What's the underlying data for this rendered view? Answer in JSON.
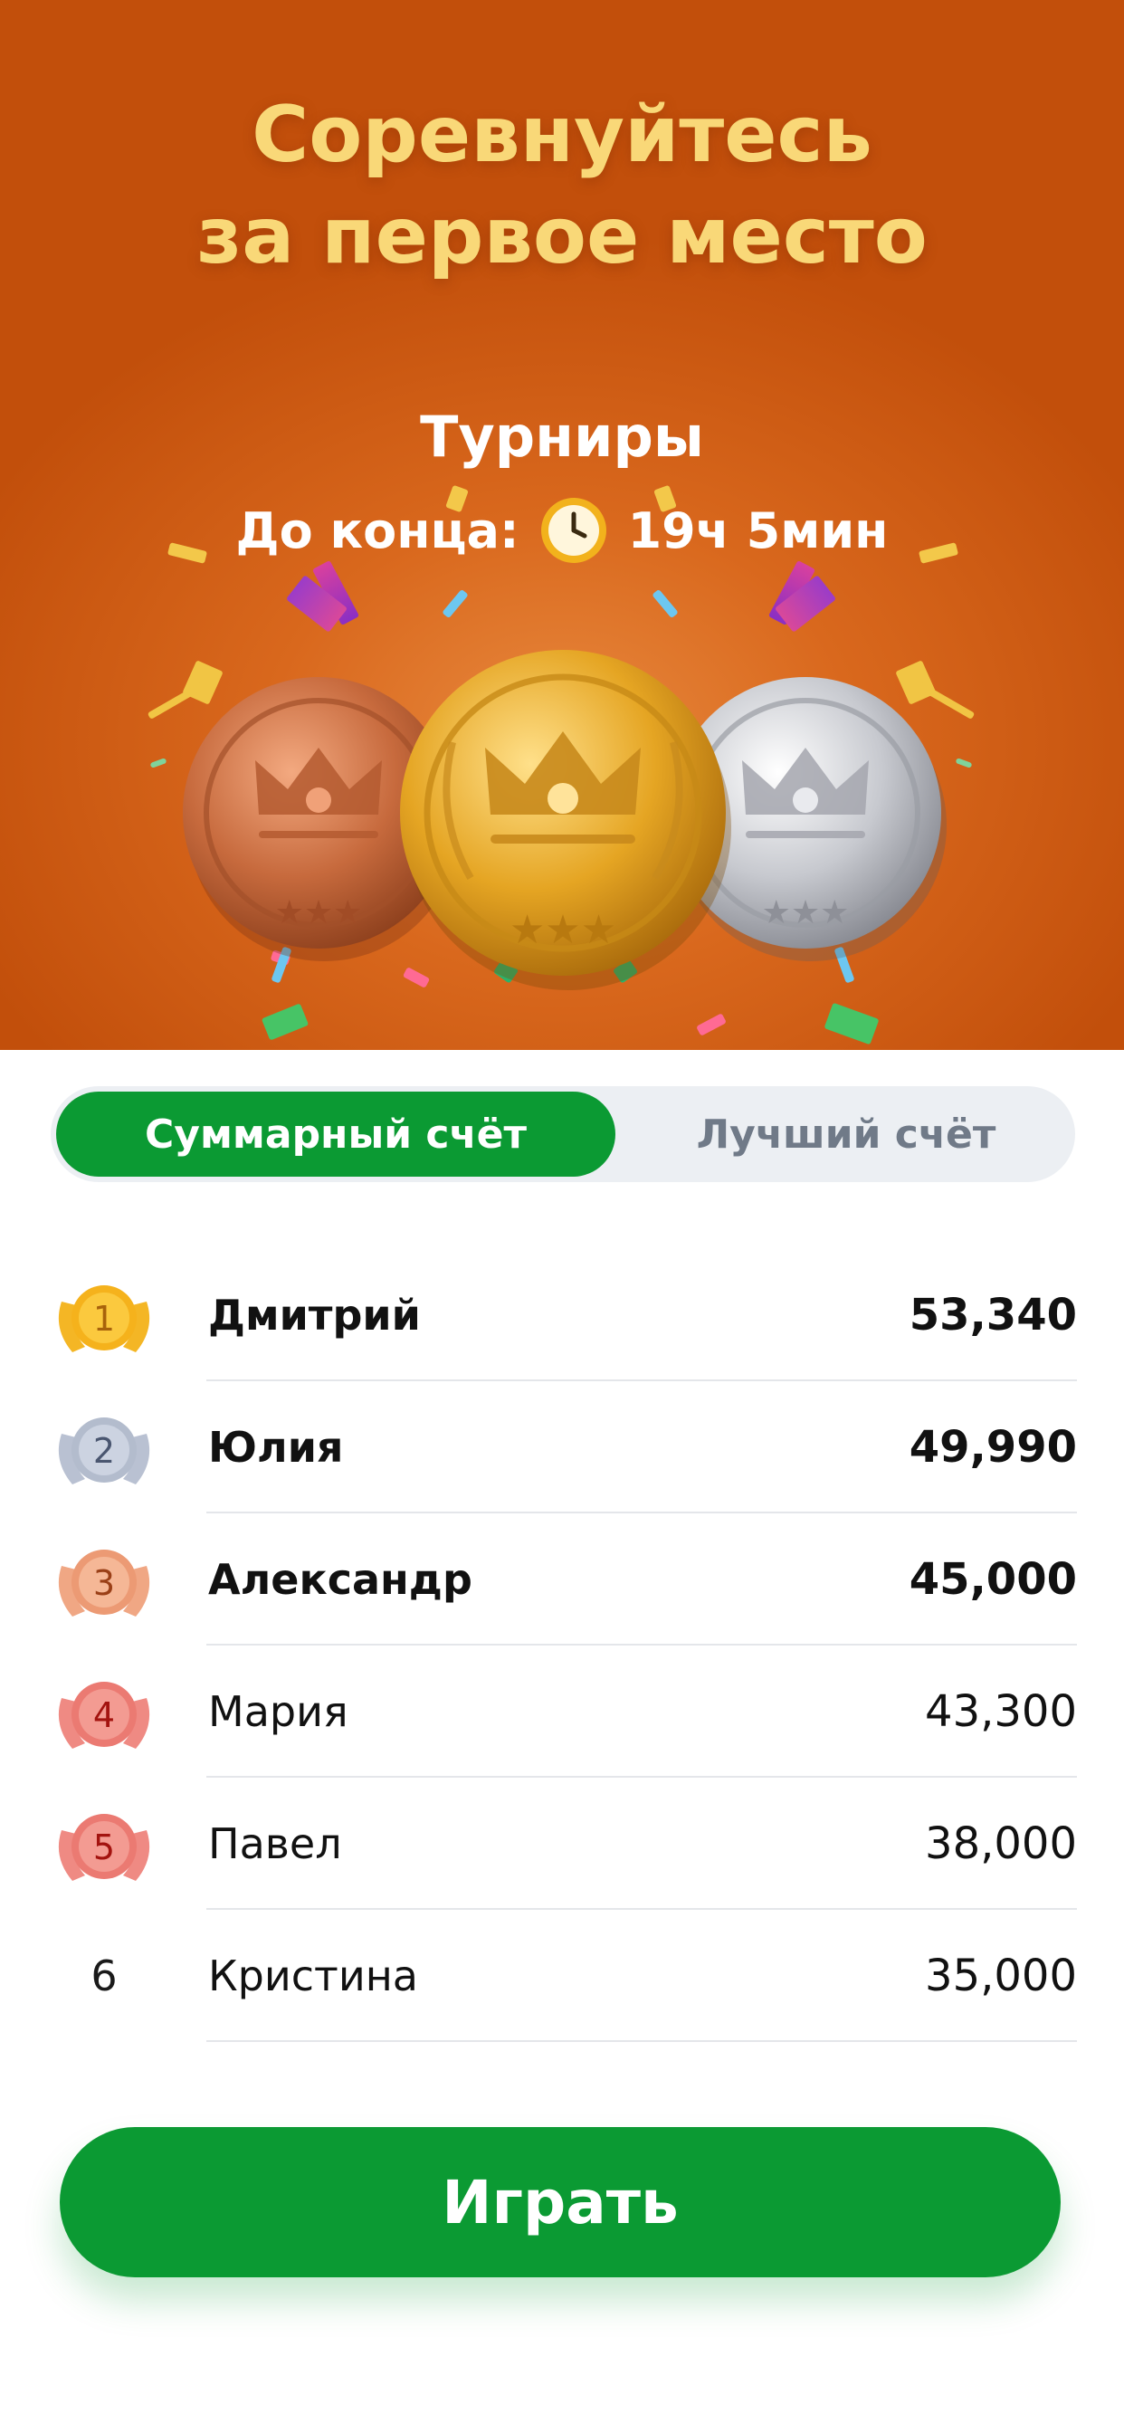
{
  "hero": {
    "title_line1": "Соревнуйтесь",
    "title_line2": "за первое место",
    "section": "Турниры",
    "timer_label": "До конца:",
    "timer_value": "19ч 5мин",
    "timer_icon": "clock-icon",
    "medal_icons": [
      "bronze-crown-medal-icon",
      "gold-crown-medal-icon",
      "silver-crown-medal-icon"
    ]
  },
  "tabs": [
    {
      "label": "Суммарный счёт",
      "selected": true
    },
    {
      "label": "Лучший счёт",
      "selected": false
    }
  ],
  "leaderboard": [
    {
      "rank": "1",
      "name": "Дмитрий",
      "score": "53,340",
      "badge": "gold"
    },
    {
      "rank": "2",
      "name": "Юлия",
      "score": "49,990",
      "badge": "silver"
    },
    {
      "rank": "3",
      "name": "Александр",
      "score": "45,000",
      "badge": "bronze"
    },
    {
      "rank": "4",
      "name": "Мария",
      "score": "43,300",
      "badge": "red"
    },
    {
      "rank": "5",
      "name": "Павел",
      "score": "38,000",
      "badge": "red"
    },
    {
      "rank": "6",
      "name": "Кристина",
      "score": "35,000",
      "badge": "none"
    }
  ],
  "play_button": {
    "label": "Играть"
  },
  "colors": {
    "accent_green": "#0b9a33",
    "hero_orange": "#d9681d",
    "title_gold": "#f9d878",
    "tab_inactive_bg": "#eceff3",
    "tab_inactive_text": "#707a88"
  }
}
